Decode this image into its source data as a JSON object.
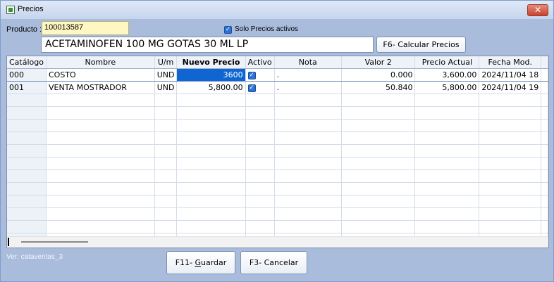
{
  "window": {
    "title": "Precios",
    "close_label": "✕"
  },
  "form": {
    "product_label": "Producto :",
    "product_code": "100013587",
    "solo_label": "Solo Precios activos",
    "description": "ACETAMINOFEN 100 MG GOTAS 30 ML LP",
    "calc_button": "F6- Calcular Precios"
  },
  "table": {
    "headers": [
      "Catálogo",
      "Nombre",
      "U/m",
      "Nuevo Precio",
      "Activo",
      "Nota",
      "Valor 2",
      "Precio Actual",
      "Fecha Mod."
    ],
    "rows": [
      {
        "catalog": "000",
        "nombre": "COSTO",
        "um": "UND",
        "nuevo_precio": "3600",
        "activo": "✓",
        "nota": ".",
        "valor2": "0.000",
        "precio_actual": "3,600.00",
        "fecha_mod": "2024/11/04 18"
      },
      {
        "catalog": "001",
        "nombre": "VENTA MOSTRADOR",
        "um": "UND",
        "nuevo_precio": "5,800.00",
        "activo": "✓",
        "nota": ".",
        "valor2": "50.840",
        "precio_actual": "5,800.00",
        "fecha_mod": "2024/11/04 19"
      }
    ]
  },
  "footer": {
    "version": "Ver: cataventas_3",
    "save_prefix": "F11- ",
    "save_key": "G",
    "save_rest": "uardar",
    "cancel": "F3- Cancelar"
  },
  "colors": {
    "background": "#a9bcdc",
    "product_input": "#fff7c2",
    "selection": "#0f66d1",
    "checkbox": "#2d73d1"
  },
  "icons": [
    "app-icon",
    "close-icon",
    "check-icon"
  ]
}
